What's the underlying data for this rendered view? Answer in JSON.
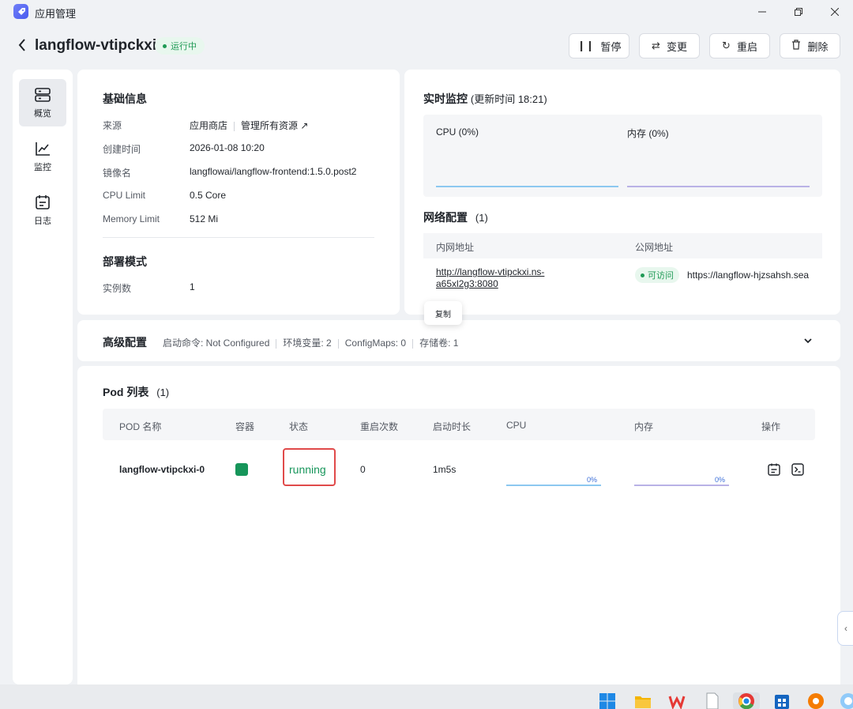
{
  "window": {
    "title": "应用管理",
    "logo": "rocket-icon"
  },
  "header": {
    "app_name": "langflow-vtipckxi",
    "status": "运行中",
    "buttons": {
      "pause": "暂停",
      "change": "变更",
      "restart": "重启",
      "delete": "删除"
    }
  },
  "nav": {
    "items": [
      {
        "label": "概览",
        "icon": "server-icon"
      },
      {
        "label": "监控",
        "icon": "chart-line-icon"
      },
      {
        "label": "日志",
        "icon": "calendar-log-icon"
      }
    ]
  },
  "basic": {
    "title": "基础信息",
    "rows": [
      {
        "label": "来源",
        "value": "应用商店",
        "link": "管理所有资源 ↗"
      },
      {
        "label": "创建时间",
        "value": "2026-01-08 10:20"
      },
      {
        "label": "镜像名",
        "value": "langflowai/langflow-frontend:1.5.0.post2"
      },
      {
        "label": "CPU Limit",
        "value": "0.5 Core"
      },
      {
        "label": "Memory Limit",
        "value": "512 Mi"
      }
    ],
    "deploy_title": "部署模式",
    "instances_label": "实例数",
    "instances_value": "1"
  },
  "monitor": {
    "title": "实时监控",
    "updated": "(更新时间  18:21)",
    "cpu_label": "CPU  (0%)",
    "mem_label": "内存  (0%)",
    "cpu_value": 0,
    "mem_value": 0
  },
  "network": {
    "title": "网络配置",
    "count": "(1)",
    "col_internal": "内网地址",
    "col_public": "公网地址",
    "internal_url": "http://langflow-vtipckxi.ns-a65xl2g3:8080",
    "access_badge": "可访问",
    "public_url": "https://langflow-hjzsahsh.sea",
    "tooltip": "复制"
  },
  "advanced": {
    "title": "高级配置",
    "start_cmd": "启动命令: Not Configured",
    "env": "环境变量: 2",
    "configmaps": "ConfigMaps: 0",
    "volumes": "存储卷: 1"
  },
  "pods": {
    "title": "Pod 列表",
    "count": "(1)",
    "columns": {
      "name": "POD 名称",
      "container": "容器",
      "status": "状态",
      "restarts": "重启次数",
      "uptime": "启动时长",
      "cpu": "CPU",
      "mem": "内存",
      "ops": "操作"
    },
    "rows": [
      {
        "name": "langflow-vtipckxi-0",
        "status": "running",
        "restarts": "0",
        "uptime": "1m5s",
        "cpu_pct": "0%",
        "mem_pct": "0%"
      }
    ]
  },
  "colors": {
    "accent_green": "#16955a",
    "highlight_red": "#e04a4a",
    "cpu_line": "#8cc8f0",
    "mem_line": "#b9b2e6"
  }
}
